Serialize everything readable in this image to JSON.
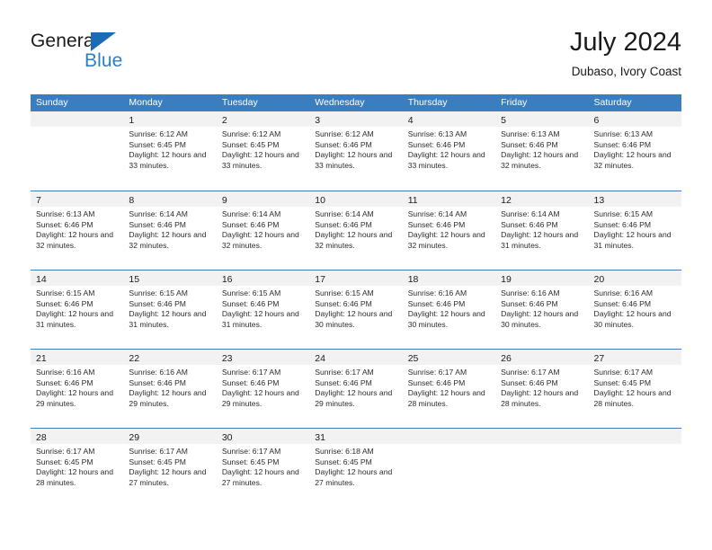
{
  "brand": {
    "word_one": "General",
    "word_two": "Blue",
    "triangle_color": "#1c6cb5",
    "blue_text_color": "#2a7fc9"
  },
  "header": {
    "title": "July 2024",
    "subtitle": "Dubaso, Ivory Coast"
  },
  "theme": {
    "header_bar_color": "#3a7ebf",
    "day_band_color": "#f2f2f2",
    "text_color": "#1a1a1a"
  },
  "weekdays": [
    "Sunday",
    "Monday",
    "Tuesday",
    "Wednesday",
    "Thursday",
    "Friday",
    "Saturday"
  ],
  "labels": {
    "sunrise_prefix": "Sunrise:",
    "sunset_prefix": "Sunset:",
    "daylight_prefix": "Daylight:"
  },
  "weeks": [
    [
      {
        "date": "",
        "empty": true
      },
      {
        "date": "1",
        "sunrise": "Sunrise: 6:12 AM",
        "sunset": "Sunset: 6:45 PM",
        "daylight": "Daylight: 12 hours and 33 minutes."
      },
      {
        "date": "2",
        "sunrise": "Sunrise: 6:12 AM",
        "sunset": "Sunset: 6:45 PM",
        "daylight": "Daylight: 12 hours and 33 minutes."
      },
      {
        "date": "3",
        "sunrise": "Sunrise: 6:12 AM",
        "sunset": "Sunset: 6:46 PM",
        "daylight": "Daylight: 12 hours and 33 minutes."
      },
      {
        "date": "4",
        "sunrise": "Sunrise: 6:13 AM",
        "sunset": "Sunset: 6:46 PM",
        "daylight": "Daylight: 12 hours and 33 minutes."
      },
      {
        "date": "5",
        "sunrise": "Sunrise: 6:13 AM",
        "sunset": "Sunset: 6:46 PM",
        "daylight": "Daylight: 12 hours and 32 minutes."
      },
      {
        "date": "6",
        "sunrise": "Sunrise: 6:13 AM",
        "sunset": "Sunset: 6:46 PM",
        "daylight": "Daylight: 12 hours and 32 minutes."
      }
    ],
    [
      {
        "date": "7",
        "sunrise": "Sunrise: 6:13 AM",
        "sunset": "Sunset: 6:46 PM",
        "daylight": "Daylight: 12 hours and 32 minutes."
      },
      {
        "date": "8",
        "sunrise": "Sunrise: 6:14 AM",
        "sunset": "Sunset: 6:46 PM",
        "daylight": "Daylight: 12 hours and 32 minutes."
      },
      {
        "date": "9",
        "sunrise": "Sunrise: 6:14 AM",
        "sunset": "Sunset: 6:46 PM",
        "daylight": "Daylight: 12 hours and 32 minutes."
      },
      {
        "date": "10",
        "sunrise": "Sunrise: 6:14 AM",
        "sunset": "Sunset: 6:46 PM",
        "daylight": "Daylight: 12 hours and 32 minutes."
      },
      {
        "date": "11",
        "sunrise": "Sunrise: 6:14 AM",
        "sunset": "Sunset: 6:46 PM",
        "daylight": "Daylight: 12 hours and 32 minutes."
      },
      {
        "date": "12",
        "sunrise": "Sunrise: 6:14 AM",
        "sunset": "Sunset: 6:46 PM",
        "daylight": "Daylight: 12 hours and 31 minutes."
      },
      {
        "date": "13",
        "sunrise": "Sunrise: 6:15 AM",
        "sunset": "Sunset: 6:46 PM",
        "daylight": "Daylight: 12 hours and 31 minutes."
      }
    ],
    [
      {
        "date": "14",
        "sunrise": "Sunrise: 6:15 AM",
        "sunset": "Sunset: 6:46 PM",
        "daylight": "Daylight: 12 hours and 31 minutes."
      },
      {
        "date": "15",
        "sunrise": "Sunrise: 6:15 AM",
        "sunset": "Sunset: 6:46 PM",
        "daylight": "Daylight: 12 hours and 31 minutes."
      },
      {
        "date": "16",
        "sunrise": "Sunrise: 6:15 AM",
        "sunset": "Sunset: 6:46 PM",
        "daylight": "Daylight: 12 hours and 31 minutes."
      },
      {
        "date": "17",
        "sunrise": "Sunrise: 6:15 AM",
        "sunset": "Sunset: 6:46 PM",
        "daylight": "Daylight: 12 hours and 30 minutes."
      },
      {
        "date": "18",
        "sunrise": "Sunrise: 6:16 AM",
        "sunset": "Sunset: 6:46 PM",
        "daylight": "Daylight: 12 hours and 30 minutes."
      },
      {
        "date": "19",
        "sunrise": "Sunrise: 6:16 AM",
        "sunset": "Sunset: 6:46 PM",
        "daylight": "Daylight: 12 hours and 30 minutes."
      },
      {
        "date": "20",
        "sunrise": "Sunrise: 6:16 AM",
        "sunset": "Sunset: 6:46 PM",
        "daylight": "Daylight: 12 hours and 30 minutes."
      }
    ],
    [
      {
        "date": "21",
        "sunrise": "Sunrise: 6:16 AM",
        "sunset": "Sunset: 6:46 PM",
        "daylight": "Daylight: 12 hours and 29 minutes."
      },
      {
        "date": "22",
        "sunrise": "Sunrise: 6:16 AM",
        "sunset": "Sunset: 6:46 PM",
        "daylight": "Daylight: 12 hours and 29 minutes."
      },
      {
        "date": "23",
        "sunrise": "Sunrise: 6:17 AM",
        "sunset": "Sunset: 6:46 PM",
        "daylight": "Daylight: 12 hours and 29 minutes."
      },
      {
        "date": "24",
        "sunrise": "Sunrise: 6:17 AM",
        "sunset": "Sunset: 6:46 PM",
        "daylight": "Daylight: 12 hours and 29 minutes."
      },
      {
        "date": "25",
        "sunrise": "Sunrise: 6:17 AM",
        "sunset": "Sunset: 6:46 PM",
        "daylight": "Daylight: 12 hours and 28 minutes."
      },
      {
        "date": "26",
        "sunrise": "Sunrise: 6:17 AM",
        "sunset": "Sunset: 6:46 PM",
        "daylight": "Daylight: 12 hours and 28 minutes."
      },
      {
        "date": "27",
        "sunrise": "Sunrise: 6:17 AM",
        "sunset": "Sunset: 6:45 PM",
        "daylight": "Daylight: 12 hours and 28 minutes."
      }
    ],
    [
      {
        "date": "28",
        "sunrise": "Sunrise: 6:17 AM",
        "sunset": "Sunset: 6:45 PM",
        "daylight": "Daylight: 12 hours and 28 minutes."
      },
      {
        "date": "29",
        "sunrise": "Sunrise: 6:17 AM",
        "sunset": "Sunset: 6:45 PM",
        "daylight": "Daylight: 12 hours and 27 minutes."
      },
      {
        "date": "30",
        "sunrise": "Sunrise: 6:17 AM",
        "sunset": "Sunset: 6:45 PM",
        "daylight": "Daylight: 12 hours and 27 minutes."
      },
      {
        "date": "31",
        "sunrise": "Sunrise: 6:18 AM",
        "sunset": "Sunset: 6:45 PM",
        "daylight": "Daylight: 12 hours and 27 minutes."
      },
      {
        "date": "",
        "empty": true
      },
      {
        "date": "",
        "empty": true
      },
      {
        "date": "",
        "empty": true
      }
    ]
  ]
}
